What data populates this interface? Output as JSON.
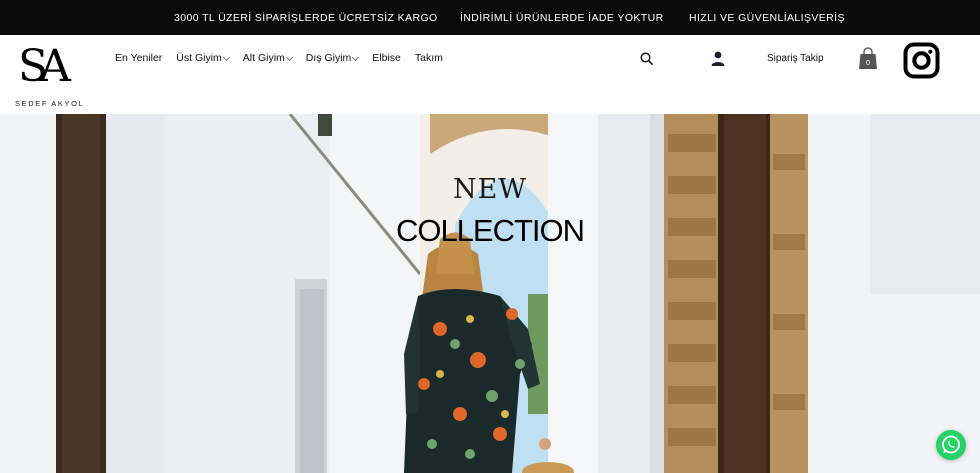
{
  "announcement": {
    "left": "3000 TL ÜZERİ SİPARİŞLERDE ÜCRETSİZ KARGO",
    "center": "İNDİRİMLİ ÜRÜNLERDE İADE YOKTUR",
    "right": "HIZLI VE GÜVENLİALIŞVERİŞ"
  },
  "brand": {
    "mark": "SA",
    "name": "SEDEF AKYOL"
  },
  "nav": {
    "items": [
      {
        "label": "En Yeniler"
      },
      {
        "label": "Üst Giyim"
      },
      {
        "label": "Alt Giyim"
      },
      {
        "label": "Dış Giyim"
      },
      {
        "label": "Elbise"
      },
      {
        "label": "Takım"
      }
    ]
  },
  "header_actions": {
    "search_icon": "search-icon",
    "account_icon": "user-icon",
    "order_tracking": "Sipariş Takip",
    "cart_icon": "shopping-bag-icon",
    "cart_count": "0",
    "social_icon": "instagram-icon"
  },
  "hero": {
    "line1": "NEW",
    "line2": "COLLECTION"
  },
  "floating": {
    "chat_icon": "whatsapp-icon"
  },
  "colors": {
    "announcement_bg": "#0a0a0a",
    "whatsapp": "#25d366"
  }
}
